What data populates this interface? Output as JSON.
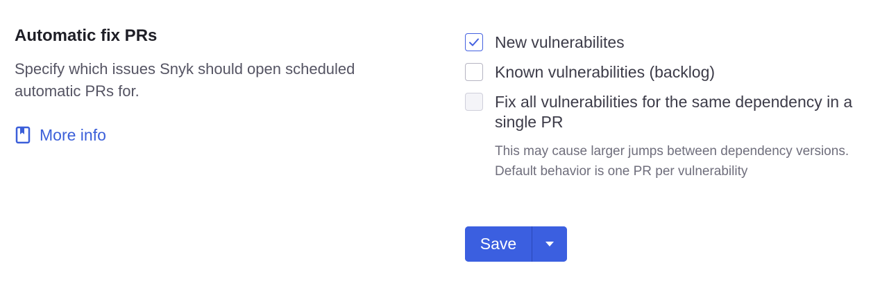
{
  "section": {
    "title": "Automatic fix PRs",
    "description": "Specify which issues Snyk should open scheduled automatic PRs for.",
    "more_info_label": "More info"
  },
  "options": [
    {
      "label": "New vulnerabilites",
      "checked": true,
      "disabled": false
    },
    {
      "label": "Known vulnerabilities (backlog)",
      "checked": false,
      "disabled": false
    },
    {
      "label": "Fix all vulnerabilities for the same dependency in a single PR",
      "checked": false,
      "disabled": true,
      "help": "This may cause larger jumps between dependency versions. Default behavior is one PR per vulnerability"
    }
  ],
  "actions": {
    "save_label": "Save"
  },
  "colors": {
    "accent": "#3b5fe0",
    "link": "#3b5fd9",
    "text": "#1e1e26",
    "muted": "#6f6e7c"
  },
  "icons": {
    "more_info": "book-icon",
    "checkbox_checked": "checkmark-icon",
    "dropdown": "caret-down-icon"
  }
}
